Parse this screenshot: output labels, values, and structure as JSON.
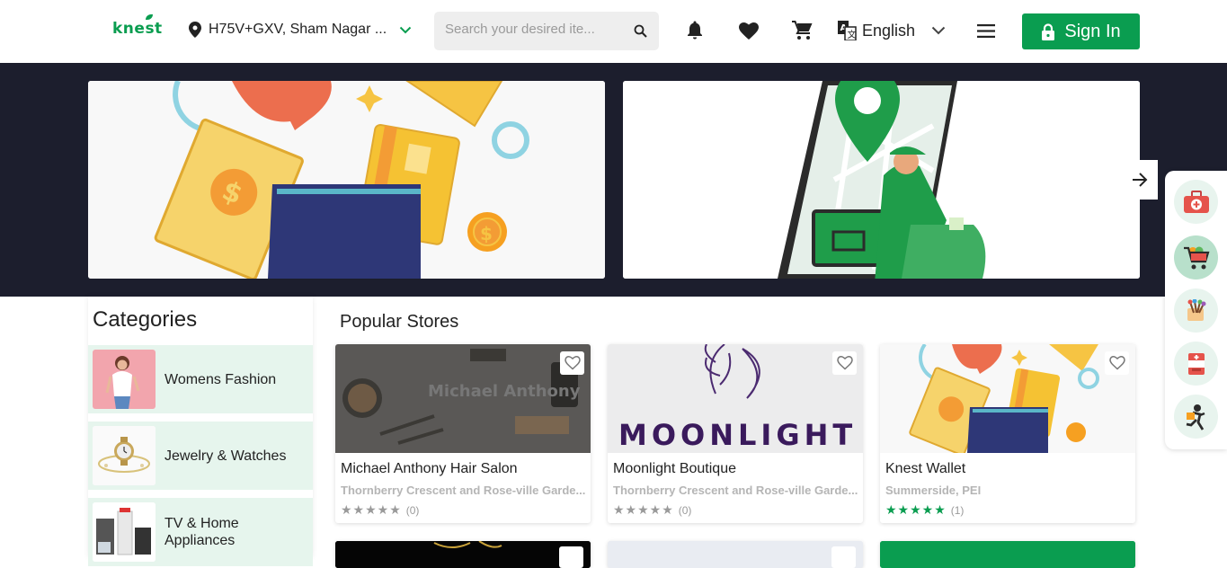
{
  "header": {
    "logo": "knest",
    "location": "H75V+GXV, Sham Nagar ...",
    "search_placeholder": "Search your desired ite...",
    "language": "English",
    "sign_in": "Sign In"
  },
  "categories": {
    "title": "Categories",
    "items": [
      {
        "label": "Womens Fashion"
      },
      {
        "label": "Jewelry & Watches"
      },
      {
        "label": "TV & Home Appliances"
      }
    ]
  },
  "stores": {
    "title": "Popular Stores",
    "items": [
      {
        "name": "Michael Anthony Hair Salon",
        "image_text": "Michael Anthony",
        "address": "Thornberry Crescent and Rose-ville Garde...",
        "stars": "★★★★★",
        "count": "(0)"
      },
      {
        "name": "Moonlight Boutique",
        "image_text": "MOONLIGHT",
        "address": "Thornberry Crescent and Rose-ville Garde...",
        "stars": "★★★★★",
        "count": "(0)"
      },
      {
        "name": "Knest Wallet",
        "address": "Summerside, PEI",
        "stars": "★★★★★",
        "count": "(1)"
      }
    ]
  },
  "colors": {
    "brand": "#0a9d50",
    "banner_bg": "#1c1e2d"
  }
}
